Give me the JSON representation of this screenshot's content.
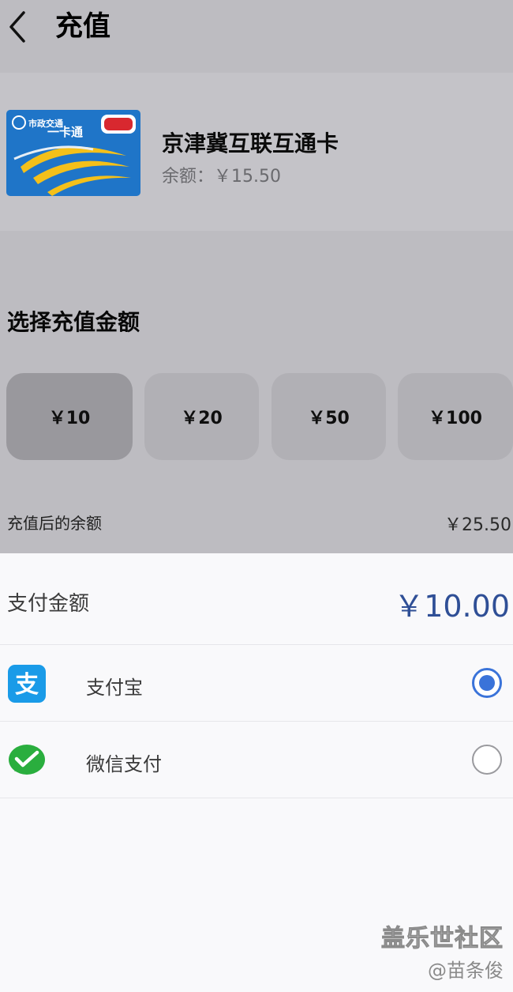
{
  "header": {
    "title": "充值"
  },
  "card": {
    "name": "京津冀互联互通卡",
    "balance": "余额：￥15.50",
    "image_text": [
      "市政交通",
      "一卡通"
    ]
  },
  "amount_section": {
    "title": "选择充值金额",
    "options": [
      "￥10",
      "￥20",
      "￥50",
      "￥100"
    ],
    "selected_index": 0
  },
  "after_balance": {
    "label": "充值后的余额",
    "value": "￥25.50"
  },
  "payment": {
    "label": "支付金额",
    "amount": "￥10.00",
    "methods": [
      {
        "label": "支付宝",
        "icon": "alipay-icon",
        "checked": true
      },
      {
        "label": "微信支付",
        "icon": "wechat-pay-icon",
        "checked": false
      }
    ]
  },
  "watermark": {
    "line1": "盖乐世社区",
    "line2": "@苗条俊"
  },
  "colors": {
    "accent_blue": "#3a73d9",
    "amount_blue": "#2f4f96",
    "overlay": "#bdbcc1",
    "alipay": "#1a9be8",
    "wechat": "#2aae3e"
  }
}
